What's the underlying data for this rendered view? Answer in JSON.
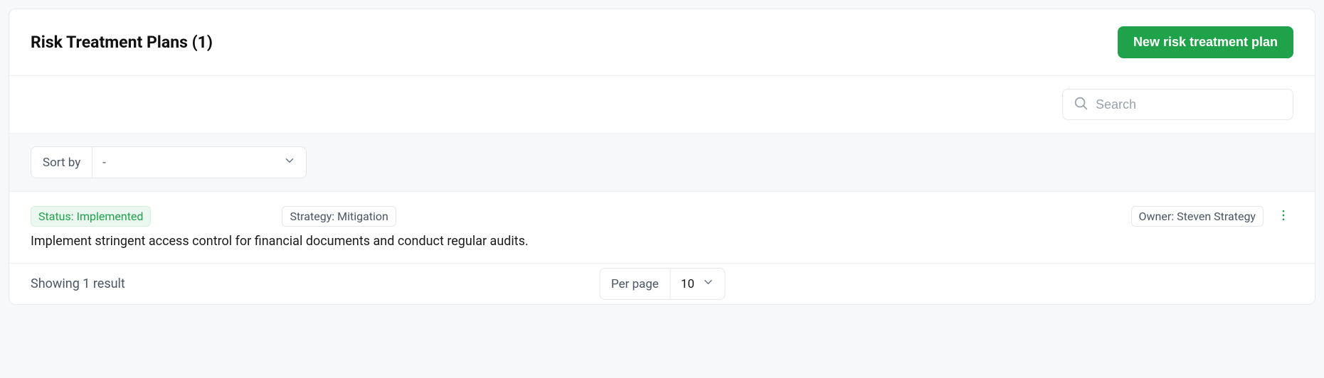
{
  "header": {
    "title": "Risk Treatment Plans (1)",
    "new_button": "New risk treatment plan"
  },
  "search": {
    "placeholder": "Search"
  },
  "sort": {
    "label": "Sort by",
    "value": "-"
  },
  "items": [
    {
      "status": "Status: Implemented",
      "strategy": "Strategy: Mitigation",
      "owner": "Owner: Steven Strategy",
      "description": "Implement stringent access control for financial documents and conduct regular audits."
    }
  ],
  "footer": {
    "results": "Showing 1 result",
    "perpage_label": "Per page",
    "perpage_value": "10"
  },
  "colors": {
    "accent_green": "#1fa24a"
  }
}
